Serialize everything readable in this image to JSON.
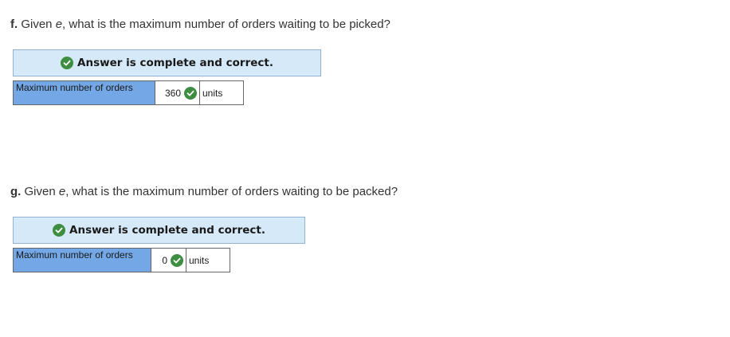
{
  "questions": [
    {
      "letter": "f.",
      "text_before": " Given ",
      "var": "e",
      "text_after": ", what is the maximum number of orders waiting to be picked?",
      "banner": "Answer is complete and correct.",
      "label": "Maximum number of orders",
      "value": "360",
      "unit": "units"
    },
    {
      "letter": "g.",
      "text_before": " Given ",
      "var": "e",
      "text_after": ", what is the maximum number of orders waiting to be packed?",
      "banner": "Answer is complete and correct.",
      "label": "Maximum number of orders",
      "value": "0",
      "unit": "units"
    }
  ],
  "colors": {
    "banner_bg": "#d6e9f8",
    "label_bg": "#74a7e5",
    "check": "#3e8e41"
  },
  "icons": [
    "check-circle-icon"
  ]
}
